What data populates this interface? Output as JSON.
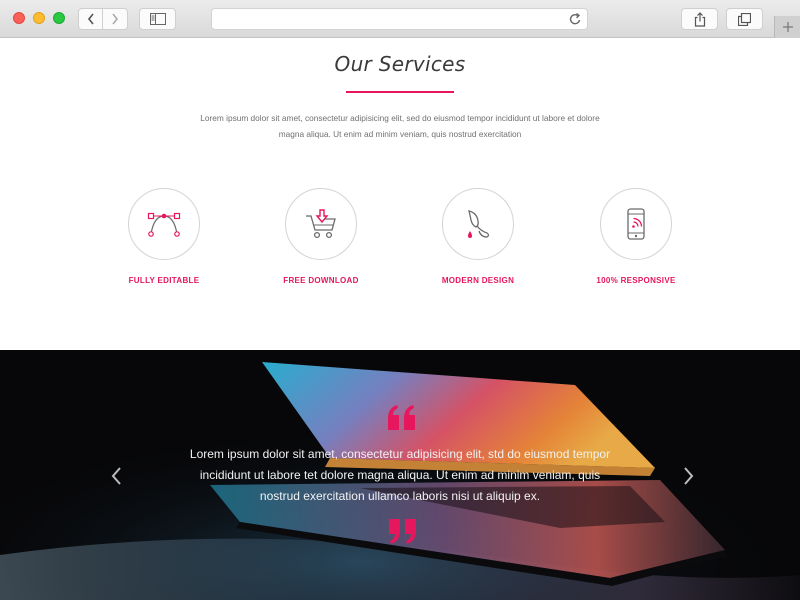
{
  "browser": {
    "address_value": "",
    "icons": [
      "back-icon",
      "forward-icon",
      "sidebar-icon",
      "reload-icon",
      "share-icon",
      "tabs-icon",
      "plus-icon"
    ]
  },
  "services": {
    "title": "Our Services",
    "intro": "Lorem ipsum dolor sit amet, consectetur adipisicing elit, sed do eiusmod tempor incididunt ut labore et dolore magna aliqua. Ut enim ad minim veniam, quis nostrud exercitation",
    "items": [
      {
        "label": "FULLY EDITABLE",
        "icon": "bezier-curve-icon"
      },
      {
        "label": "FREE DOWNLOAD",
        "icon": "cart-download-icon"
      },
      {
        "label": "MODERN DESIGN",
        "icon": "paint-brush-icon"
      },
      {
        "label": "100% RESPONSIVE",
        "icon": "mobile-signal-icon"
      }
    ]
  },
  "testimonial": {
    "text": "Lorem ipsum dolor sit amet, consectetur adipisicing elit, std do eiusmod tempor incididunt ut labore tet dolore magna aliqua. Ut enim ad minim veniam, quis nostrud exercitation ullamco laboris nisi ut aliquip ex.",
    "icons": [
      "quote-open-icon",
      "quote-close-icon",
      "chevron-left-icon",
      "chevron-right-icon"
    ]
  },
  "colors": {
    "accent": "#e6175c",
    "dark_background": "#070709"
  }
}
